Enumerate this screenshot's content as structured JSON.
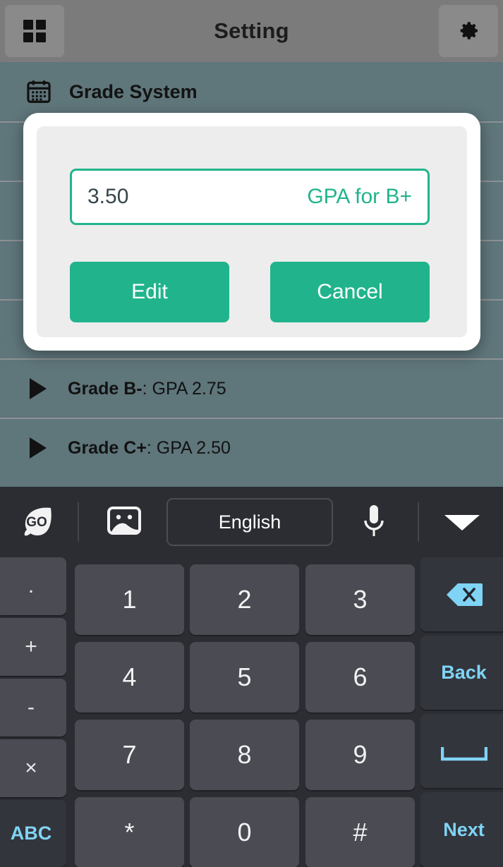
{
  "header": {
    "title": "Setting",
    "left_button": "apps-grid-icon",
    "right_button": "gear-icon"
  },
  "content": {
    "section_icon": "calendar-icon",
    "section_title": "Grade System",
    "rows": [
      {
        "label": "Grade B-",
        "value": "GPA 2.75"
      },
      {
        "label": "Grade C+",
        "value": "GPA 2.50"
      }
    ]
  },
  "dialog": {
    "input_value": "3.50",
    "input_label": "GPA for B+",
    "edit_label": "Edit",
    "cancel_label": "Cancel",
    "accent_color": "#21b48c",
    "panel_color": "#ededed",
    "surface_color": "#ffffff"
  },
  "keyboard": {
    "toolbar": {
      "logo": "go-keyboard-logo",
      "emoji": "emoji-icon",
      "language": "English",
      "mic": "microphone-icon",
      "collapse": "chevron-down-icon"
    },
    "left_column": [
      ".",
      "+",
      "-",
      "×",
      "ABC"
    ],
    "rows": [
      [
        "1",
        "2",
        "3"
      ],
      [
        "4",
        "5",
        "6"
      ],
      [
        "7",
        "8",
        "9"
      ],
      [
        "*",
        "0",
        "#"
      ]
    ],
    "right_column": [
      "backspace-icon",
      "Back",
      "space-icon",
      "Next"
    ],
    "right_labels": {
      "backspace": "",
      "back": "Back",
      "space": "",
      "next": "Next"
    },
    "key_color": "#4a4b53",
    "func_key_color": "#33353c",
    "func_text_color": "#7fd4f5",
    "panel_color": "#2b2d33"
  }
}
